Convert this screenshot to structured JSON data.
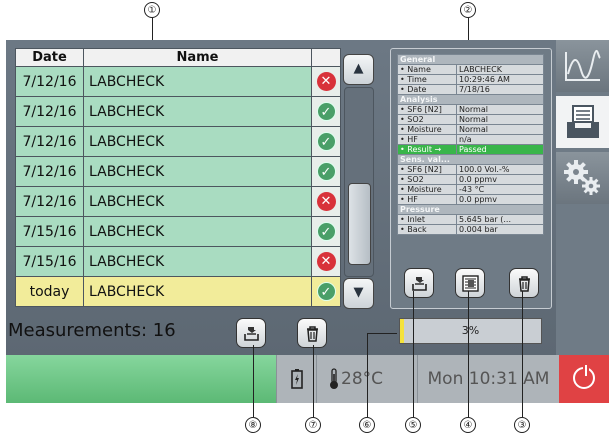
{
  "callouts": [
    "①",
    "②",
    "③",
    "④",
    "⑤",
    "⑥",
    "⑦",
    "⑧"
  ],
  "table": {
    "headers": {
      "date": "Date",
      "name": "Name"
    },
    "rows": [
      {
        "date": "7/12/16",
        "name": "LABCHECK",
        "status": "fail"
      },
      {
        "date": "7/12/16",
        "name": "LABCHECK",
        "status": "ok"
      },
      {
        "date": "7/12/16",
        "name": "LABCHECK",
        "status": "ok"
      },
      {
        "date": "7/12/16",
        "name": "LABCHECK",
        "status": "ok"
      },
      {
        "date": "7/12/16",
        "name": "LABCHECK",
        "status": "fail"
      },
      {
        "date": "7/15/16",
        "name": "LABCHECK",
        "status": "ok"
      },
      {
        "date": "7/15/16",
        "name": "LABCHECK",
        "status": "fail"
      },
      {
        "date": "today",
        "name": "LABCHECK",
        "status": "ok",
        "selected": true
      }
    ]
  },
  "detail": {
    "sections": [
      {
        "title": "General",
        "rows": [
          [
            "• Name",
            "LABCHECK"
          ],
          [
            "• Time",
            "10:29:46 AM"
          ],
          [
            "• Date",
            "7/18/16"
          ]
        ]
      },
      {
        "title": "Analysis",
        "rows": [
          [
            "• SF6 [N2]",
            "Normal"
          ],
          [
            "• SO2",
            "Normal"
          ],
          [
            "• Moisture",
            "Normal"
          ],
          [
            "• HF",
            "n/a"
          ],
          [
            "• Result →",
            "Passed"
          ]
        ]
      },
      {
        "title": "Sens. val...",
        "rows": [
          [
            "• SF6 [N2]",
            "100.0 Vol.-%"
          ],
          [
            "• SO2",
            "0.0 ppmv"
          ],
          [
            "• Moisture",
            "-43 °C"
          ],
          [
            "• HF",
            "0.0 ppmv"
          ]
        ]
      },
      {
        "title": "Pressure",
        "rows": [
          [
            "• Inlet",
            "5.645 bar (..."
          ],
          [
            "• Back",
            "0.004 bar"
          ]
        ]
      }
    ],
    "highlight_label": "• Result →"
  },
  "measurements_label": "Measurements: 16",
  "progress": {
    "label": "3%",
    "value": 0.03
  },
  "status": {
    "temperature": "28°C",
    "datetime": "Mon 10:31 AM"
  },
  "colors": {
    "row_bg": "#a9dcc1",
    "selected_bg": "#f2ec9a",
    "fail": "#d8323a",
    "ok": "#4a9f68",
    "result_green": "#39b54a",
    "power": "#e04244",
    "status_green": "#6cc585",
    "progress_fill": "#f4e23b"
  },
  "icons": {
    "status_ok": "check-icon",
    "status_fail": "cross-icon",
    "scroll_up": "▲",
    "scroll_down": "▼",
    "tab_graph": "graph-icon",
    "tab_list": "tray-list-icon",
    "tab_settings": "gears-icon",
    "export": "tray-export-icon",
    "report": "report-icon",
    "delete": "trash-icon",
    "battery": "battery-icon",
    "thermometer": "thermometer-icon",
    "power": "power-icon"
  }
}
